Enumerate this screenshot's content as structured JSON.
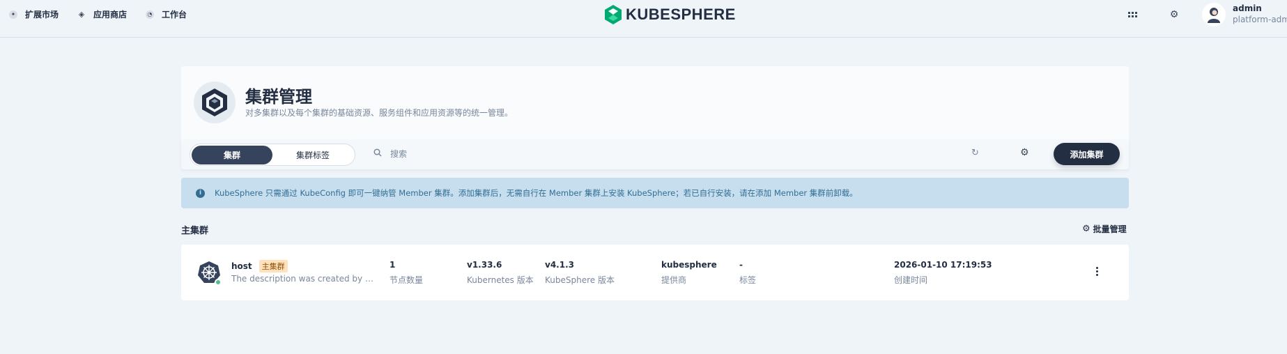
{
  "topbar": {
    "nav": [
      {
        "label": "扩展市场",
        "icon": "extension-icon"
      },
      {
        "label": "应用商店",
        "icon": "app-store-icon"
      },
      {
        "label": "工作台",
        "icon": "workbench-icon"
      }
    ],
    "logo_text": "KUBESPHERE",
    "user": {
      "name": "admin",
      "role": "platform-admin"
    }
  },
  "header": {
    "title": "集群管理",
    "description": "对多集群以及每个集群的基础资源、服务组件和应用资源等的统一管理。"
  },
  "toolbar": {
    "tabs": [
      {
        "label": "集群",
        "active": true
      },
      {
        "label": "集群标签",
        "active": false
      }
    ],
    "search_placeholder": "搜索",
    "add_button": "添加集群"
  },
  "banner": {
    "text": "KubeSphere 只需通过 KubeConfig 即可一键纳管 Member 集群。添加集群后，无需自行在 Member 集群上安装 KubeSphere；若已自行安装，请在添加 Member 集群前卸载。"
  },
  "section": {
    "title": "主集群",
    "batch_label": "批量管理"
  },
  "cluster": {
    "name": "host",
    "badge": "主集群",
    "description": "The description was created by KubeSphere",
    "status": "running",
    "columns": [
      {
        "value": "1",
        "label": "节点数量"
      },
      {
        "value": "v1.33.6",
        "label": "Kubernetes 版本"
      },
      {
        "value": "v4.1.3",
        "label": "KubeSphere 版本"
      },
      {
        "value": "kubesphere",
        "label": "提供商"
      },
      {
        "value": "-",
        "label": "标签"
      },
      {
        "value": "2026-01-10 17:19:53",
        "label": "创建时间"
      }
    ]
  },
  "colors": {
    "background": "#eff4f9",
    "primary_dark": "#242e42",
    "banner_bg": "#c7deef",
    "banner_text": "#326e93",
    "status_green": "#55bc8a",
    "badge_bg": "#ffe1be"
  }
}
